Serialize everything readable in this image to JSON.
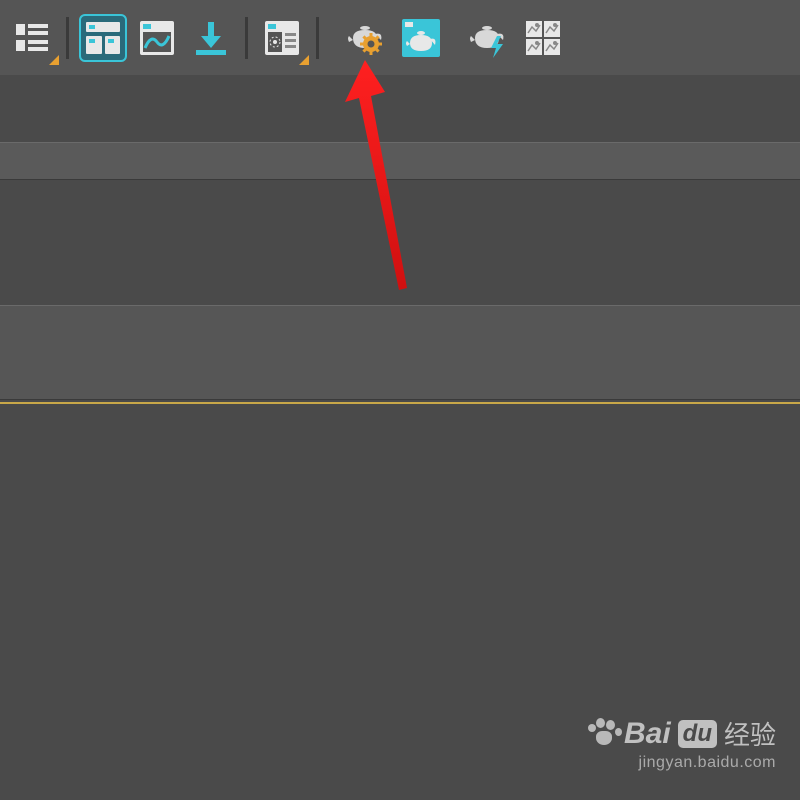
{
  "toolbar": {
    "buttons": [
      {
        "name": "layout-list-icon",
        "hasCorner": true
      },
      {
        "name": "panel-layout-icon",
        "selected": true
      },
      {
        "name": "curve-editor-icon"
      },
      {
        "name": "download-icon"
      },
      {
        "name": "render-setup-icon",
        "hasCorner": true
      },
      {
        "name": "teapot-material-icon"
      },
      {
        "name": "teapot-render-icon"
      },
      {
        "name": "teapot-quick-render-icon"
      },
      {
        "name": "viewport-grid-icon"
      }
    ]
  },
  "watermark": {
    "brand_bai": "Bai",
    "brand_du": "du",
    "brand_suffix": "经验",
    "url": "jingyan.baidu.com"
  },
  "colors": {
    "accent_teal": "#3ac5d8",
    "accent_orange": "#e8a030",
    "arrow_red": "#e81515",
    "yellow_line": "#c9a849"
  }
}
